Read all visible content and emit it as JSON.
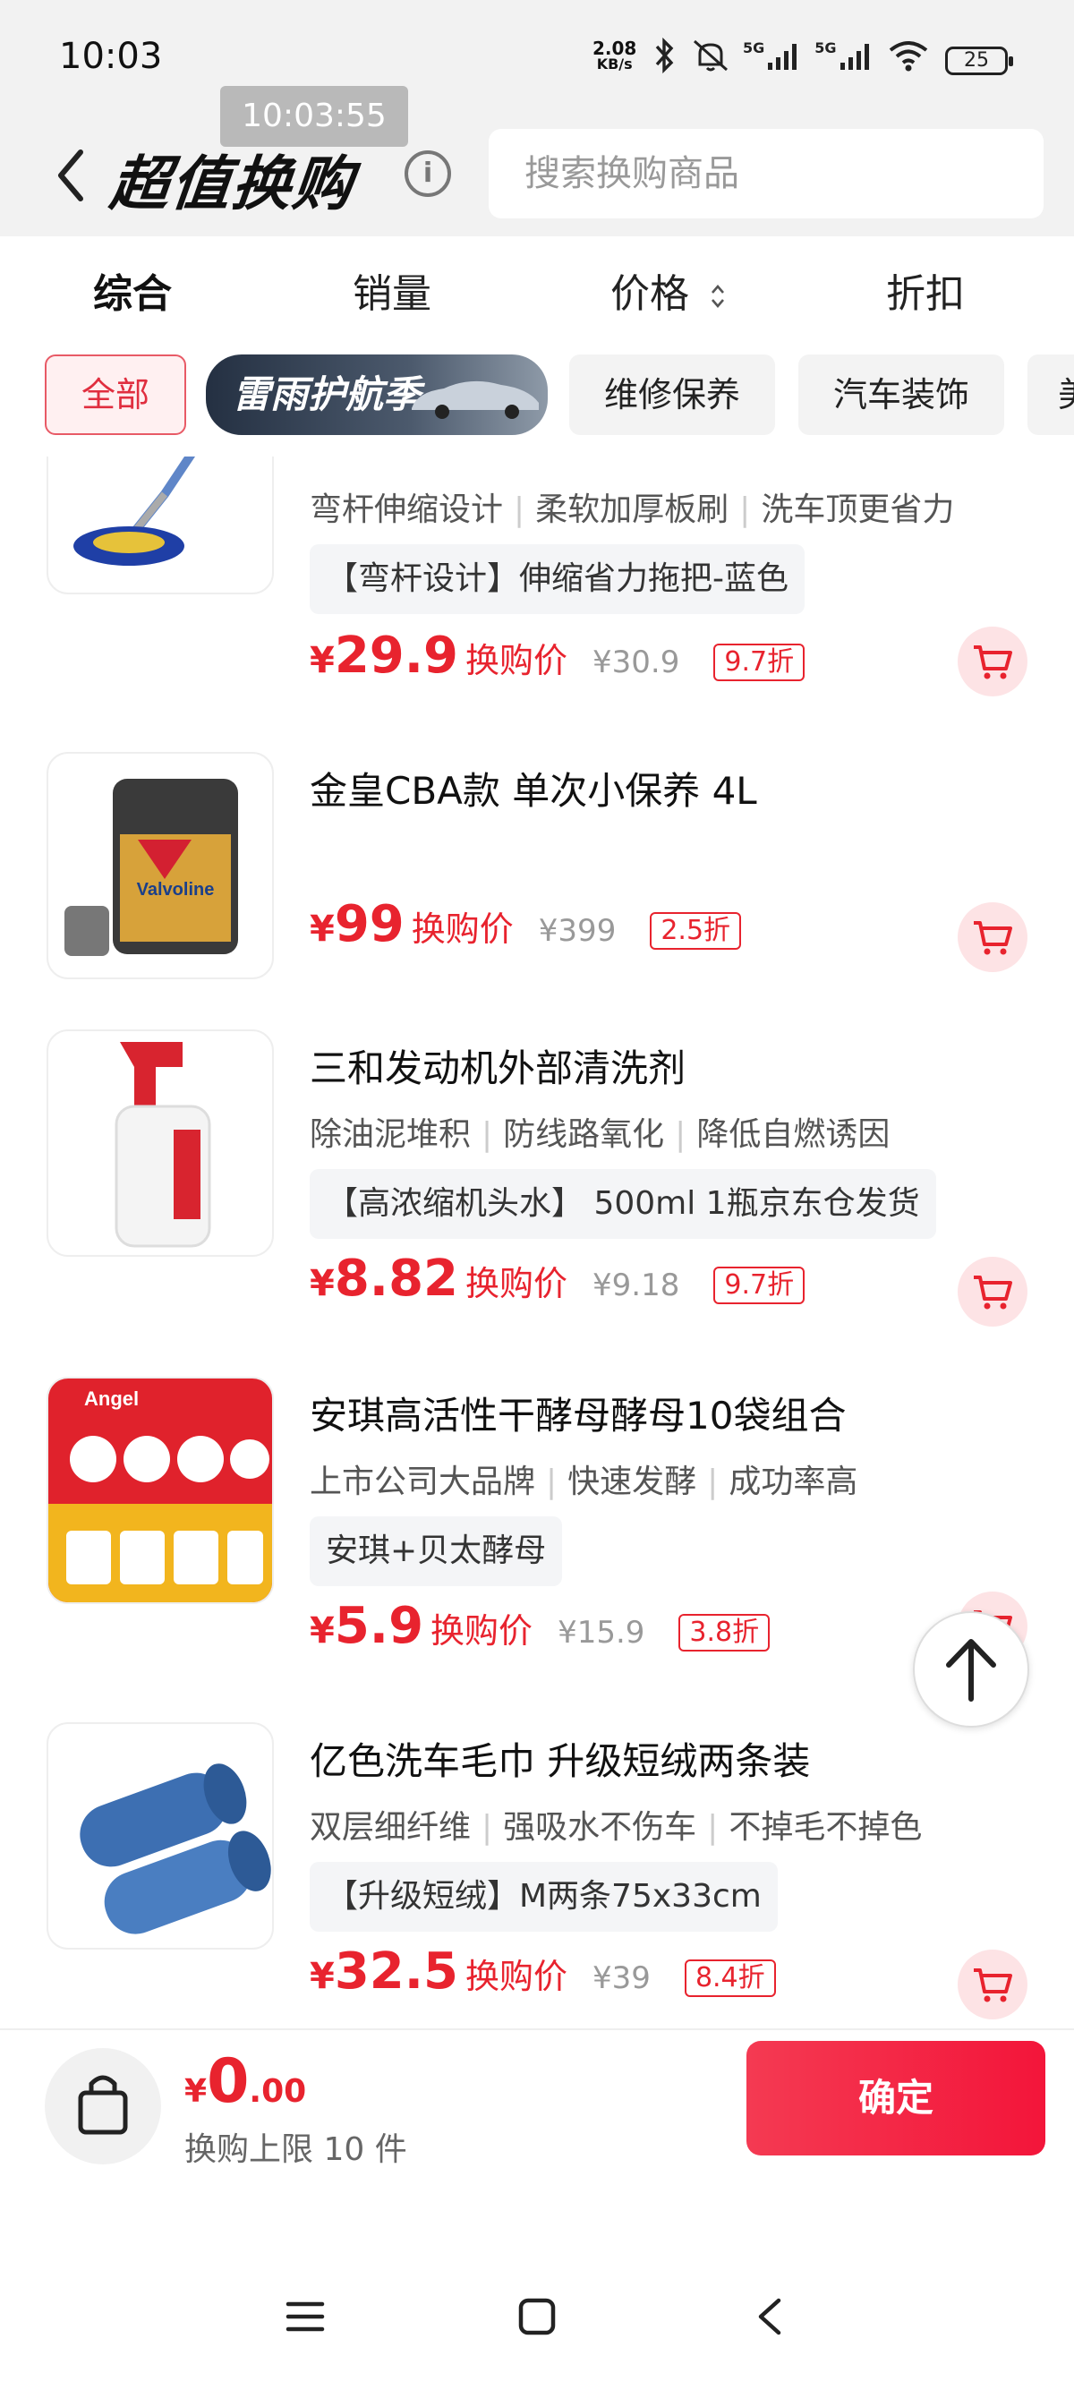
{
  "status_bar": {
    "time": "10:03",
    "net_speed_value": "2.08",
    "net_speed_unit": "KB/s",
    "signal_1": "5G",
    "signal_2": "5G",
    "battery": "25",
    "clock_overlay": "10:03:55"
  },
  "header": {
    "title": "超值换购",
    "info_icon": "info-icon",
    "search_placeholder": "搜索换购商品"
  },
  "sort_tabs": [
    {
      "label": "综合",
      "active": true
    },
    {
      "label": "销量",
      "active": false
    },
    {
      "label": "价格",
      "active": false
    },
    {
      "label": "折扣",
      "active": false
    }
  ],
  "category_chips": [
    {
      "label": "全部",
      "selected": true
    },
    {
      "label": "雷雨护航季",
      "selected": false
    },
    {
      "label": "维修保养",
      "selected": false
    },
    {
      "label": "汽车装饰",
      "selected": false
    },
    {
      "label": "美",
      "selected": false
    }
  ],
  "products": [
    {
      "name": "",
      "features": [
        "弯杆伸缩设计",
        "柔软加厚板刷",
        "洗车顶更省力"
      ],
      "spec": "【弯杆设计】伸缩省力拖把-蓝色",
      "currency": "¥",
      "price": "29.9",
      "price_tag": "换购价",
      "original_price": "¥30.9",
      "discount": "9.7折"
    },
    {
      "name": "金皇CBA款 单次小保养 4L",
      "features": [],
      "spec": "",
      "currency": "¥",
      "price": "99",
      "price_tag": "换购价",
      "original_price": "¥399",
      "discount": "2.5折",
      "image_text": "Valvoline"
    },
    {
      "name": "三和发动机外部清洗剂",
      "features": [
        "除油泥堆积",
        "防线路氧化",
        "降低自燃诱因"
      ],
      "spec": "【高浓缩机头水】 500ml 1瓶京东仓发货",
      "currency": "¥",
      "price": "8.82",
      "price_tag": "换购价",
      "original_price": "¥9.18",
      "discount": "9.7折"
    },
    {
      "name": "安琪高活性干酵母酵母10袋组合",
      "features": [
        "上市公司大品牌",
        "快速发酵",
        "成功率高"
      ],
      "spec": "安琪+贝太酵母",
      "currency": "¥",
      "price": "5.9",
      "price_tag": "换购价",
      "original_price": "¥15.9",
      "discount": "3.8折",
      "image_text": "Angel"
    },
    {
      "name": "亿色洗车毛巾 升级短绒两条装",
      "features": [
        "双层细纤维",
        "强吸水不伤车",
        "不掉毛不掉色"
      ],
      "spec": "【升级短绒】M两条75x33cm",
      "currency": "¥",
      "price": "32.5",
      "price_tag": "换购价",
      "original_price": "¥39",
      "discount": "8.4折"
    }
  ],
  "bottom_bar": {
    "currency": "¥",
    "total_int": "0",
    "total_dec": ".00",
    "limit_text": "换购上限 10 件",
    "confirm_label": "确定"
  },
  "colors": {
    "accent": "#e8232e",
    "confirm_gradient_start": "#f43a52",
    "confirm_gradient_end": "#f3153a",
    "header_bg": "#f2f2f2"
  }
}
